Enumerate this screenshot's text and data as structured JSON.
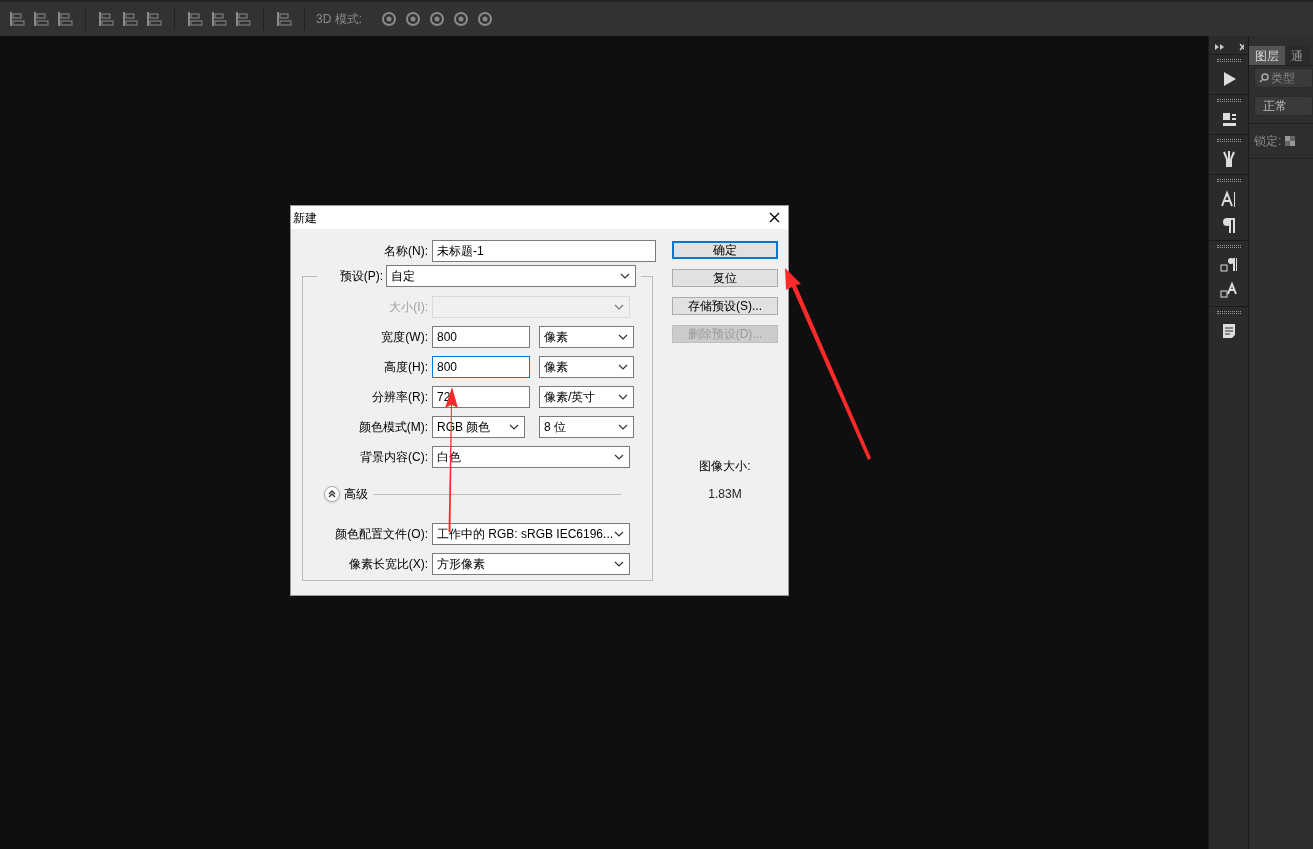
{
  "toolbar": {
    "mode_label": "3D 模式:"
  },
  "dialog": {
    "title": "新建",
    "name": {
      "label": "名称(N):",
      "value": "未标题-1"
    },
    "preset": {
      "label": "预设(P):",
      "value": "自定"
    },
    "rows": [
      {
        "kind": "select",
        "label": "大小(I):",
        "disabled": true,
        "focused": false
      },
      {
        "kind": "measure",
        "label": "宽度(W):",
        "value": "800",
        "unit": "像素",
        "disabled": false,
        "focused": false
      },
      {
        "kind": "measure",
        "label": "高度(H):",
        "value": "800",
        "unit": "像素",
        "disabled": false,
        "focused": true
      },
      {
        "kind": "measure",
        "label": "分辨率(R):",
        "value": "72",
        "unit": "像素/英寸",
        "disabled": false,
        "focused": false
      },
      {
        "kind": "select_pair",
        "label": "颜色模式(M):",
        "value": "RGB 颜色",
        "unit": "8 位",
        "disabled": false,
        "focused": false
      },
      {
        "kind": "select",
        "label": "背景内容(C):",
        "value": "白色",
        "disabled": false,
        "focused": false
      }
    ],
    "advanced": {
      "label": "高级",
      "expanded": true
    },
    "advanced_rows": [
      {
        "kind": "select",
        "label": "颜色配置文件(O):",
        "value": "工作中的 RGB: sRGB IEC6196...",
        "disabled": false,
        "focused": false
      },
      {
        "kind": "select",
        "label": "像素长宽比(X):",
        "value": "方形像素",
        "disabled": false,
        "focused": false
      }
    ],
    "buttons": [
      {
        "label": "确定",
        "default": true,
        "disabled": false
      },
      {
        "label": "复位",
        "default": false,
        "disabled": false
      },
      {
        "label": "存储预设(S)...",
        "default": false,
        "disabled": false
      },
      {
        "label": "删除预设(D)...",
        "default": false,
        "disabled": true
      }
    ],
    "image_size": {
      "label": "图像大小:",
      "value": "1.83M"
    }
  },
  "panel": {
    "tabs": [
      {
        "label": "图层",
        "selected": true
      },
      {
        "label": "通",
        "selected": false
      }
    ],
    "search_placeholder": "类型",
    "blend_mode": "正常",
    "lock_label": "锁定:"
  }
}
